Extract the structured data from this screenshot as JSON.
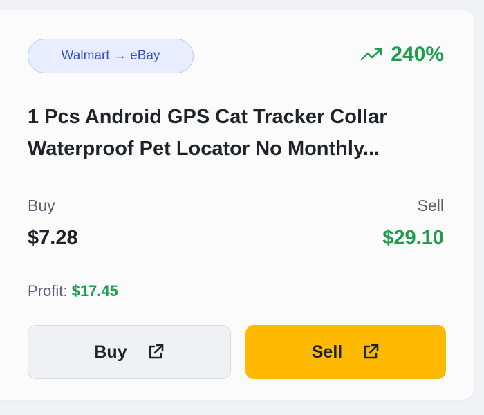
{
  "card": {
    "route": "Walmart → eBay",
    "roi": "240%",
    "roi_icon": "trending-up-icon",
    "title": "1 Pcs Android GPS Cat Tracker Collar Waterproof Pet Locator No Monthly...",
    "buy_label": "Buy",
    "sell_label": "Sell",
    "buy_price": "$7.28",
    "sell_price": "$29.10",
    "profit_label": "Profit:",
    "profit_value": "$17.45",
    "buy_button": "Buy",
    "sell_button": "Sell",
    "button_icon": "external-link-icon"
  },
  "colors": {
    "positive": "#1f9d4d",
    "sell_button": "#ffba00",
    "badge_text": "#2f4fd0"
  }
}
